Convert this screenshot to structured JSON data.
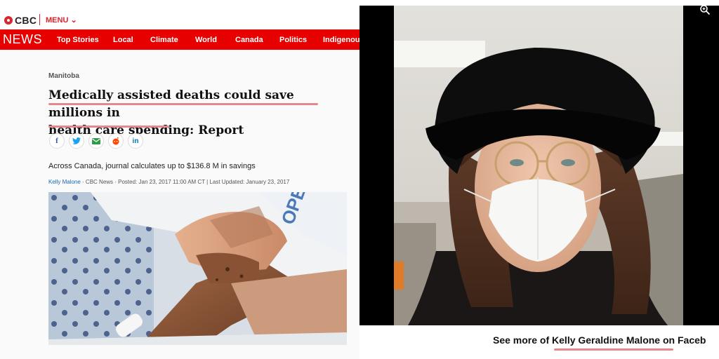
{
  "article": {
    "brand": "CBC",
    "menu_label": "MENU",
    "menu_caret": "⌄",
    "nav_title": "NEWS",
    "nav_items": [
      "Top Stories",
      "Local",
      "Climate",
      "World",
      "Canada",
      "Politics",
      "Indigenous"
    ],
    "section": "Manitoba",
    "headline_line1": "Medically assisted deaths could save millions in",
    "headline_line2": "health care spending: Report",
    "share_icons": [
      {
        "name": "facebook-icon",
        "glyph": "f",
        "color": "#3b5998"
      },
      {
        "name": "twitter-icon",
        "glyph": "🐦",
        "color": "#1da1f2"
      },
      {
        "name": "email-icon",
        "glyph": "✉",
        "color": "#2e9d4a"
      },
      {
        "name": "reddit-icon",
        "glyph": "●",
        "color": "#ff4500"
      },
      {
        "name": "linkedin-icon",
        "glyph": "in",
        "color": "#0077b5"
      }
    ],
    "deck": "Across Canada, journal calculates up to $136.8 M in savings",
    "byline_author": "Kelly Malone",
    "byline_rest": " · CBC News · Posted: Jan 23, 2017 11:00 AM CT | Last Updated: January 23, 2017",
    "photo_text": "OPE"
  },
  "post": {
    "caption_prefix": "See more of ",
    "caption_name": "Kelly Geraldine Malone",
    "caption_suffix": " on Faceb"
  },
  "colors": {
    "cbc_red": "#e60000",
    "highlight_underline": "#e8868c",
    "link_blue": "#1a66b3"
  }
}
